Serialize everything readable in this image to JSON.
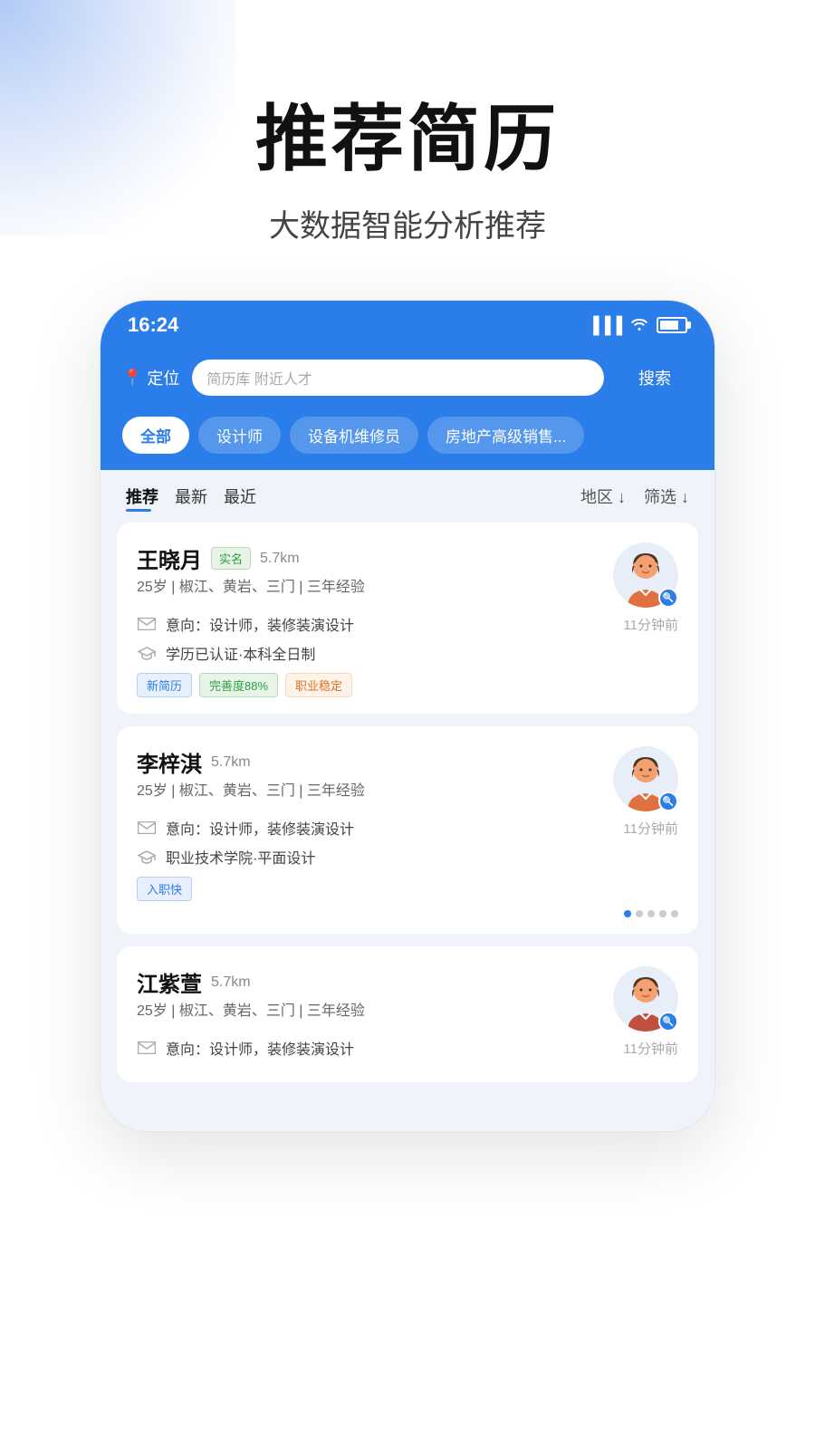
{
  "hero": {
    "title": "推荐简历",
    "subtitle": "大数据智能分析推荐"
  },
  "phone": {
    "statusBar": {
      "time": "16:24"
    },
    "searchArea": {
      "locationLabel": "定位",
      "searchPlaceholder": "简历库  附近人才",
      "searchButton": "搜索"
    },
    "categories": [
      {
        "label": "全部",
        "active": true
      },
      {
        "label": "设计师",
        "active": false
      },
      {
        "label": "设备机维修员",
        "active": false
      },
      {
        "label": "房地产高级销售...",
        "active": false
      }
    ],
    "sortBar": {
      "tabs": [
        {
          "label": "推荐",
          "active": true
        },
        {
          "label": "最新",
          "active": false
        },
        {
          "label": "最近",
          "active": false
        }
      ],
      "filters": [
        {
          "label": "地区"
        },
        {
          "label": "筛选"
        }
      ]
    },
    "resumeCards": [
      {
        "name": "王晓月",
        "verified": "实名",
        "distance": "5.7km",
        "info": "25岁 | 椒江、黄岩、三门 | 三年经验",
        "intention": "意向：设计师，装修装演设计",
        "education": "学历已认证·本科全日制",
        "time": "11分钟前",
        "tags": [
          {
            "label": "新简历",
            "type": "blue"
          },
          {
            "label": "完善度88%",
            "type": "green"
          },
          {
            "label": "职业稳定",
            "type": "orange"
          }
        ],
        "showDots": false
      },
      {
        "name": "李梓淇",
        "verified": "",
        "distance": "5.7km",
        "info": "25岁 | 椒江、黄岩、三门 | 三年经验",
        "intention": "意向：设计师，装修装演设计",
        "education": "职业技术学院·平面设计",
        "time": "11分钟前",
        "tags": [
          {
            "label": "入职快",
            "type": "blue"
          }
        ],
        "showDots": true
      },
      {
        "name": "江紫萱",
        "verified": "",
        "distance": "5.7km",
        "info": "25岁 | 椒江、黄岩、三门 | 三年经验",
        "intention": "意向：设计师，装修装演设计",
        "education": "",
        "time": "11分钟前",
        "tags": [],
        "showDots": false
      }
    ]
  }
}
